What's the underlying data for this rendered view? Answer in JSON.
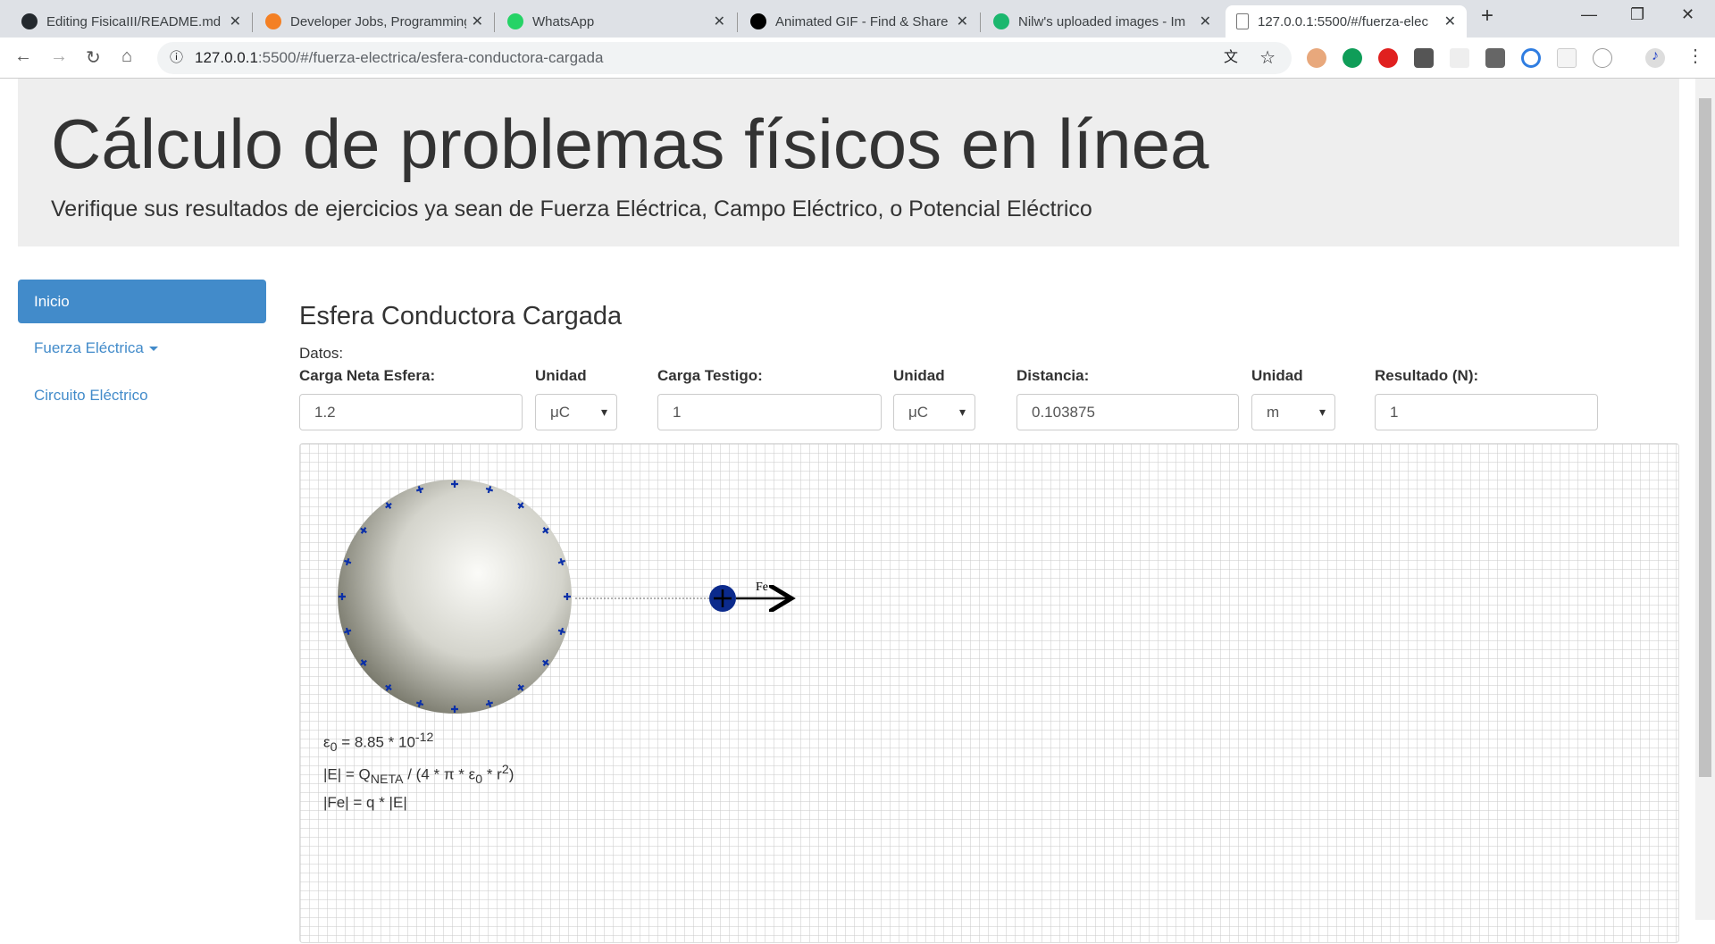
{
  "browser": {
    "tabs": [
      {
        "title": "Editing FisicaIII/README.md",
        "icon": "github-icon",
        "color": "#24292e"
      },
      {
        "title": "Developer Jobs, Programming",
        "icon": "stackoverflow-icon",
        "color": "#f48024"
      },
      {
        "title": "WhatsApp",
        "icon": "whatsapp-icon",
        "color": "#25d366"
      },
      {
        "title": "Animated GIF - Find & Share",
        "icon": "giphy-icon",
        "color": "#000000"
      },
      {
        "title": "Nilw's uploaded images - Im",
        "icon": "imgur-icon",
        "color": "#1bb76e"
      },
      {
        "title": "127.0.0.1:5500/#/fuerza-elec",
        "icon": "page-icon",
        "color": "#ffffff",
        "active": true
      }
    ],
    "url_host": "127.0.0.1",
    "url_path": ":5500/#/fuerza-electrica/esfera-conductora-cargada"
  },
  "header": {
    "title": "Cálculo de problemas físicos en línea",
    "subtitle": "Verifique sus resultados de ejercicios ya sean de Fuerza Eléctrica, Campo Eléctrico, o Potencial Eléctrico"
  },
  "sidebar": {
    "items": [
      {
        "label": "Inicio"
      },
      {
        "label": "Fuerza Eléctrica"
      },
      {
        "label": "Circuito Eléctrico"
      }
    ]
  },
  "main": {
    "title": "Esfera Conductora Cargada",
    "datos": "Datos:",
    "fields": [
      {
        "label": "Carga Neta Esfera:",
        "value": "1.2"
      },
      {
        "label": "Unidad",
        "value": "μC"
      },
      {
        "label": "Carga Testigo:",
        "value": "1"
      },
      {
        "label": "Unidad",
        "value": "μC"
      },
      {
        "label": "Distancia:",
        "value": "0.103875"
      },
      {
        "label": "Unidad",
        "value": "m"
      },
      {
        "label": "Resultado (N):",
        "value": "1"
      }
    ],
    "diagram": {
      "force_label": "Fe",
      "charge_color": "#0a2fa8",
      "test_charge_color": "#0b2a8c"
    },
    "formulas": {
      "l1_a": "ε",
      "l1_sub": "0",
      "l1_b": " = 8.85 * 10",
      "l1_sup": "-12",
      "l2_a": "|E| = Q",
      "l2_sub": "NETA",
      "l2_b": " / (4 * π * ε",
      "l2_sub2": "0",
      "l2_c": " * r",
      "l2_sup": "2",
      "l2_d": ")",
      "l3": "|Fe| = q * |E|"
    }
  }
}
